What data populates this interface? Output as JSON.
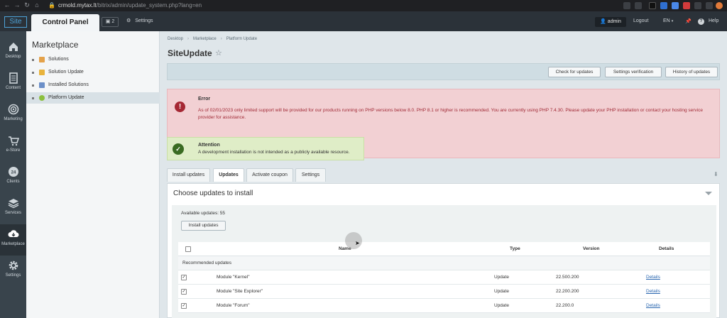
{
  "browser": {
    "url_host": "crmold.mytax.lt",
    "url_path": "/bitrix/admin/update_system.php?lang=en"
  },
  "app": {
    "logo": "Site",
    "control_panel": "Control Panel",
    "notifications_count": "2",
    "settings_label": "Settings",
    "user": "admin",
    "logout": "Logout",
    "language": "EN",
    "help": "Help"
  },
  "rail": [
    {
      "label": "Desktop",
      "icon": "home-icon"
    },
    {
      "label": "Content",
      "icon": "document-icon"
    },
    {
      "label": "Marketing",
      "icon": "target-icon"
    },
    {
      "label": "e-Store",
      "icon": "cart-icon"
    },
    {
      "label": "Clients",
      "icon": "clock-24-icon"
    },
    {
      "label": "Services",
      "icon": "layers-icon"
    },
    {
      "label": "Marketplace",
      "icon": "cloud-download-icon"
    },
    {
      "label": "Settings",
      "icon": "gear-icon"
    }
  ],
  "sidebar": {
    "title": "Marketplace",
    "items": [
      {
        "label": "Solutions"
      },
      {
        "label": "Solution Update"
      },
      {
        "label": "Installed Solutions"
      },
      {
        "label": "Platform Update"
      }
    ]
  },
  "breadcrumb": [
    "Desktop",
    "Marketplace",
    "Platform Update"
  ],
  "page_title": "SiteUpdate",
  "toolbar": {
    "check": "Check for updates",
    "verify": "Settings verification",
    "history": "History of updates"
  },
  "error": {
    "title": "Error",
    "text": "As of 02/01/2023 only limited support will be provided for our products running on PHP versions below 8.0. PHP 8.1 or higher is recommended. You are currently using PHP 7.4.30. Please update your PHP installation or contact your hosting service provider for assistance."
  },
  "attention": {
    "title": "Attention",
    "text": "A development installation is not intended as a publicly available resource."
  },
  "tabs": [
    "Install updates",
    "Updates",
    "Activate coupon",
    "Settings"
  ],
  "panel": {
    "title": "Choose updates to install",
    "available": "Available updates: 55",
    "install_button": "Install updates"
  },
  "table": {
    "headers": {
      "name": "Name",
      "type": "Type",
      "version": "Version",
      "details": "Details"
    },
    "group": "Recommended updates",
    "rows": [
      {
        "name": "Module \"Kernel\"",
        "type": "Update",
        "version": "22.500.200",
        "details": "Details"
      },
      {
        "name": "Module \"Site Explorer\"",
        "type": "Update",
        "version": "22.200.200",
        "details": "Details"
      },
      {
        "name": "Module \"Forum\"",
        "type": "Update",
        "version": "22.200.0",
        "details": "Details"
      }
    ]
  },
  "colors": {
    "error_text": "#a12a36",
    "error_bg": "#f2d0d3",
    "attention_bg": "#dfedc7",
    "rail_bg": "#39444c",
    "link": "#2a67b0"
  }
}
